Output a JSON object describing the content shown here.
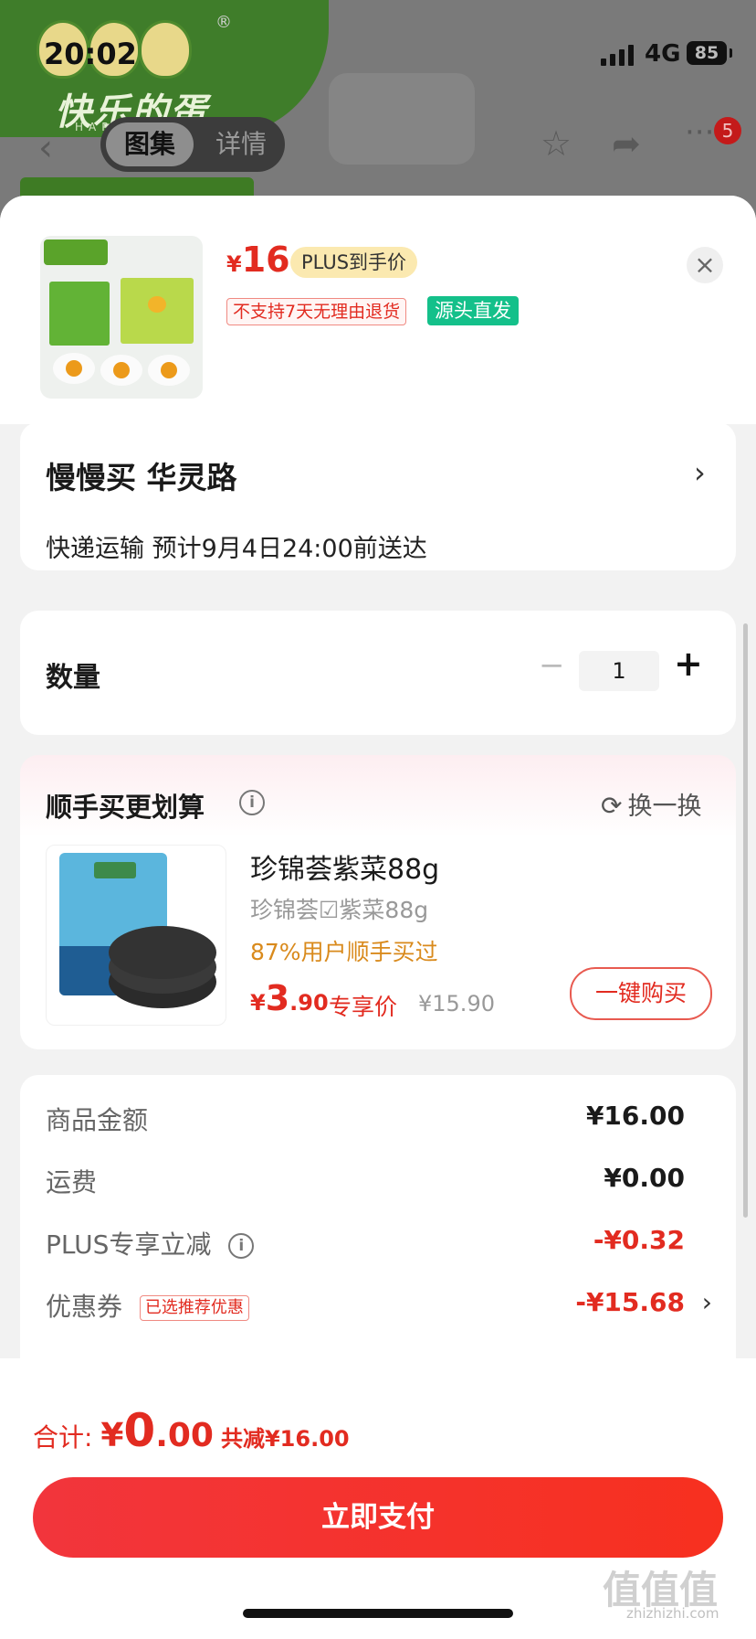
{
  "status_bar": {
    "time": "20:02",
    "network": "4G",
    "battery": "85"
  },
  "background_page": {
    "logo_text": "快乐的蛋",
    "logo_sub": "HAPPY EGG",
    "trademark": "®",
    "tabs": [
      "图集",
      "详情"
    ],
    "notification_count": "5"
  },
  "product": {
    "currency": "¥",
    "price": "16",
    "plus_tag": "PLUS到手价",
    "return_policy": "不支持7天无理由退货",
    "source_tag": "源头直发"
  },
  "address": {
    "name": "慢慢买  华灵路",
    "shipping": "快递运输 预计9月4日24:00前送达"
  },
  "quantity": {
    "label": "数量",
    "value": "1",
    "minus": "−",
    "plus": "+"
  },
  "recommend": {
    "title": "顺手买更划算",
    "swap_label": "换一换",
    "item": {
      "name": "珍锦荟紫菜88g",
      "subtitle": "珍锦荟☑紫菜88g",
      "bought_text": "87%用户顺手买过",
      "price_currency": "¥",
      "price_int": "3",
      "price_dec": ".90",
      "exclusive_label": "专享价",
      "original_price": "¥15.90",
      "buy_label": "一键购买"
    }
  },
  "summary": {
    "rows": [
      {
        "label": "商品金额",
        "value": "¥16.00"
      },
      {
        "label": "运费",
        "value": "¥0.00"
      },
      {
        "label": "PLUS专享立减",
        "value": "-¥0.32"
      },
      {
        "label": "优惠券",
        "value": "-¥15.68",
        "tag": "已选推荐优惠"
      }
    ]
  },
  "footer": {
    "total_label": "合计: ",
    "total_currency": "¥",
    "total_int": "0",
    "total_dec": ".00",
    "saved_text": "共减¥16.00",
    "pay_label": "立即支付",
    "watermark": "值值值",
    "watermark_sub": "zhizhizhi.com"
  },
  "colors": {
    "accent_red": "#e22b20",
    "teal": "#14c08a",
    "plus_gold": "#fbe9b0"
  }
}
